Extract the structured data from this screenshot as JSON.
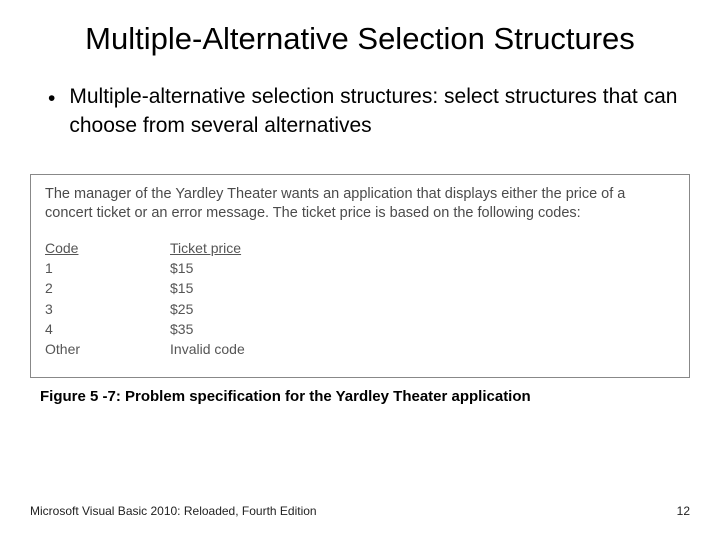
{
  "title": "Multiple-Alternative Selection Structures",
  "bullet": "Multiple-alternative selection structures: select structures that can choose from several alternatives",
  "problem": {
    "description": "The manager of the Yardley Theater wants an application that displays either the price of a concert ticket or an error message. The ticket price is based on the following codes:",
    "headers": {
      "code": "Code",
      "price": "Ticket price"
    },
    "rows": [
      {
        "code": "1",
        "price": "$15"
      },
      {
        "code": "2",
        "price": "$15"
      },
      {
        "code": "3",
        "price": "$25"
      },
      {
        "code": "4",
        "price": "$35"
      },
      {
        "code": "Other",
        "price": "Invalid code"
      }
    ]
  },
  "caption": "Figure 5 -7: Problem specification for the Yardley Theater application",
  "footer": {
    "source": "Microsoft Visual Basic 2010: Reloaded, Fourth Edition",
    "page": "12"
  }
}
